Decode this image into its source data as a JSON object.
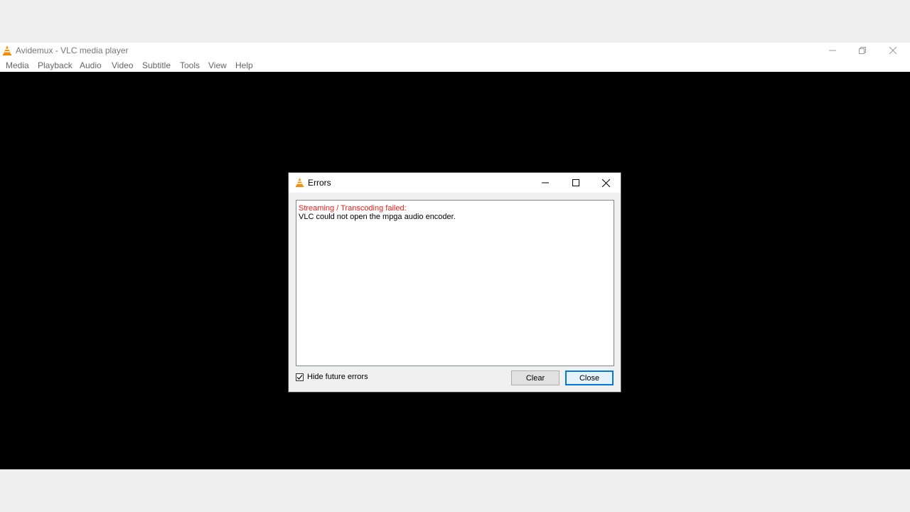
{
  "window": {
    "title": "Avidemux - VLC media player",
    "icon": "vlc-cone-icon",
    "controls": [
      "minimize-icon",
      "restore-icon",
      "close-icon"
    ]
  },
  "menu": {
    "items": [
      {
        "label": "Media"
      },
      {
        "label": "Playback"
      },
      {
        "label": "Audio"
      },
      {
        "label": "Video"
      },
      {
        "label": "Subtitle"
      },
      {
        "label": "Tools"
      },
      {
        "label": "View"
      },
      {
        "label": "Help"
      }
    ]
  },
  "dialog": {
    "title": "Errors",
    "icon": "vlc-cone-icon",
    "messages": {
      "heading": "Streaming / Transcoding failed:",
      "detail": "VLC could not open the mpga audio encoder."
    },
    "hide_future_errors": {
      "label": "Hide future errors",
      "checked": true
    },
    "buttons": {
      "clear": "Clear",
      "close": "Close"
    }
  },
  "colors": {
    "error_text": "#e8231f",
    "video_background": "#000000",
    "default_button_border": "#0078d7"
  }
}
